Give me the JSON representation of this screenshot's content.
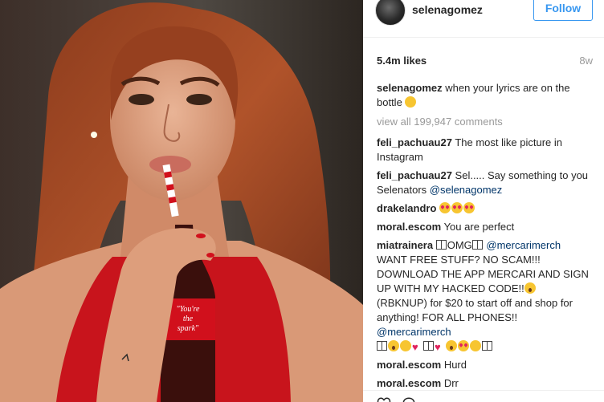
{
  "post": {
    "username": "selenagomez",
    "follow_label": "Follow",
    "likes": "5.4m likes",
    "age": "8w"
  },
  "caption": {
    "user": "selenagomez",
    "text": " when your lyrics are on the bottle"
  },
  "view_all": "view all 199,947 comments",
  "comments": [
    {
      "user": "feli_pachuau27",
      "text": " The most like picture in Instagram"
    },
    {
      "user": "feli_pachuau27",
      "text": " Sel..... Say something to you Selenators ",
      "mention": "@selenagomez"
    },
    {
      "user": "drakelandro",
      "text": " "
    },
    {
      "user": "moral.escom",
      "text": " You are perfect"
    },
    {
      "user": "miatrainera",
      "text_a": "OMG",
      "mention_a": "@mercarimerch",
      "text_b": "WANT FREE STUFF? NO SCAM!!! DOWNLOAD THE APP MERCARI AND SIGN UP WITH MY HACKED CODE!!",
      "text_c": "(RBKNUP) for $20 to start off and shop for anything! FOR ALL PHONES!!",
      "mention_b": "@mercarimerch"
    },
    {
      "user": "moral.escom",
      "text": " Hurd"
    },
    {
      "user": "moral.escom",
      "text": " Drr"
    }
  ],
  "photo": {
    "bottle_text_1": "\"You're",
    "bottle_text_2": "the",
    "bottle_text_3": "spark\""
  },
  "colors": {
    "accent": "#3897f0",
    "mention": "#003569",
    "muted": "#999999",
    "coke_red": "#d1101c"
  }
}
